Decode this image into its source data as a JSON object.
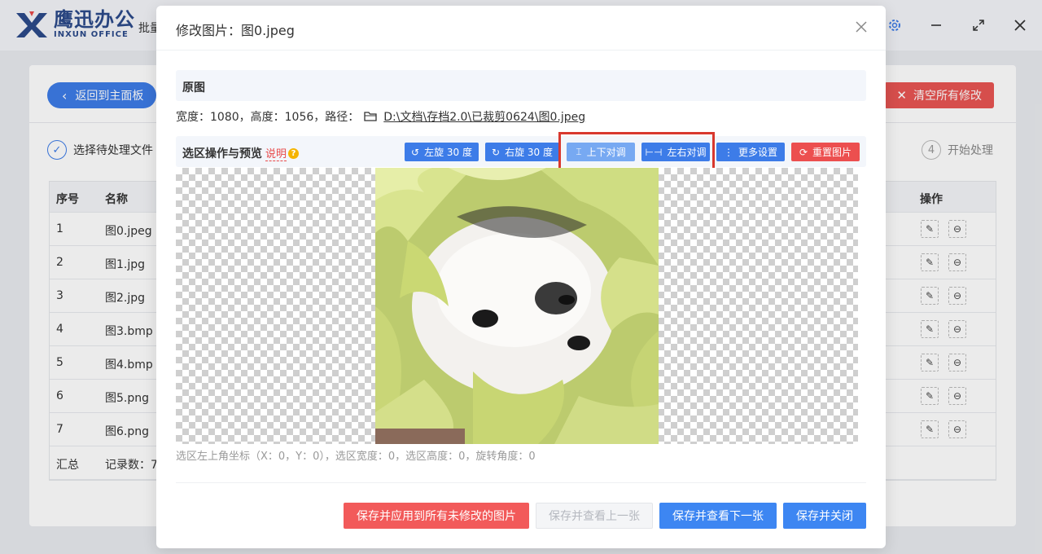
{
  "app": {
    "logo_cn": "鹰迅办公",
    "logo_en": "INXUN OFFICE",
    "header_title": "批量",
    "back_label": "返回到主面板",
    "clear_label": "清空所有修改",
    "step1_num": "",
    "step1_label": "选择待处理文件",
    "step4_num": "4",
    "step4_label": "开始处理",
    "table": {
      "headers": [
        "序号",
        "名称",
        "操作"
      ],
      "rows": [
        {
          "idx": "1",
          "name": "图0.jpeg"
        },
        {
          "idx": "2",
          "name": "图1.jpg"
        },
        {
          "idx": "3",
          "name": "图2.jpg"
        },
        {
          "idx": "4",
          "name": "图3.bmp"
        },
        {
          "idx": "5",
          "name": "图4.bmp"
        },
        {
          "idx": "6",
          "name": "图5.png"
        },
        {
          "idx": "7",
          "name": "图6.png"
        }
      ],
      "summary_label": "汇总",
      "summary_count": "记录数：7"
    }
  },
  "modal": {
    "title": "修改图片：图0.jpeg",
    "original_section": "原图",
    "info_prefix": "宽度：1080，高度：1056，路径：",
    "path": "D:\\文档\\存档2.0\\已裁剪0624\\图0.jpeg",
    "ops_label": "选区操作与预览",
    "explain_label": "说明",
    "tools": {
      "rotate_left": "左旋 30 度",
      "rotate_right": "右旋 30 度",
      "flip_vertical": "上下对调",
      "flip_horizontal": "左右对调",
      "more_settings": "更多设置",
      "reset_image": "重置图片"
    },
    "coords_text": "选区左上角坐标（X：0，Y：0），选区宽度：0，选区高度：0，旋转角度：0",
    "footer": {
      "apply_all": "保存并应用到所有未修改的图片",
      "prev": "保存并查看上一张",
      "next": "保存并查看下一张",
      "close": "保存并关闭"
    }
  },
  "colors": {
    "primary": "#3d7ce8",
    "danger": "#ec4f4f",
    "highlight": "#d8382e"
  }
}
